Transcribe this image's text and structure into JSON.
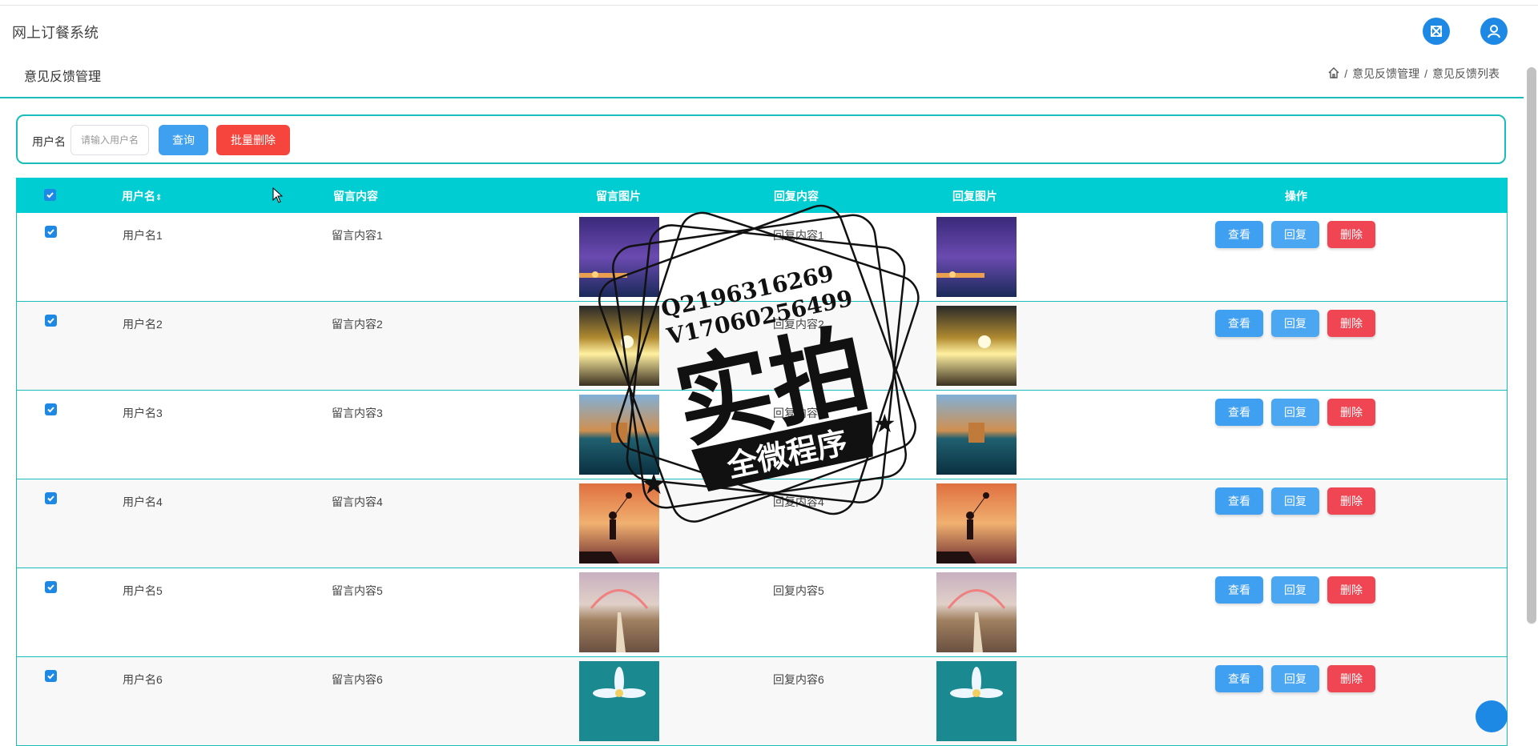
{
  "app_title": "网上订餐系统",
  "page_title": "意见反馈管理",
  "breadcrumb": {
    "sep": "/",
    "level1": "意见反馈管理",
    "level2": "意见反馈列表"
  },
  "search": {
    "label": "用户名",
    "placeholder": "请输入用户名",
    "query_button": "查询",
    "batch_delete_button": "批量删除"
  },
  "table": {
    "headers": {
      "username": "用户名",
      "sort_glyph": "⇕",
      "message_content": "留言内容",
      "message_image": "留言图片",
      "reply_content": "回复内容",
      "reply_image": "回复图片",
      "actions": "操作"
    },
    "rows": [
      {
        "username": "用户名1",
        "message": "留言内容1",
        "reply": "回复内容1"
      },
      {
        "username": "用户名2",
        "message": "留言内容2",
        "reply": "回复内容2"
      },
      {
        "username": "用户名3",
        "message": "留言内容3",
        "reply": "回复内容3"
      },
      {
        "username": "用户名4",
        "message": "留言内容4",
        "reply": "回复内容4"
      },
      {
        "username": "用户名5",
        "message": "留言内容5",
        "reply": "回复内容5"
      },
      {
        "username": "用户名6",
        "message": "留言内容6",
        "reply": "回复内容6"
      }
    ],
    "action_labels": {
      "view": "查看",
      "reply": "回复",
      "delete": "删除"
    }
  },
  "watermark": {
    "line1": "Q2196316269",
    "line2": "V17060256499",
    "main": "实拍",
    "banner": "全微程序"
  },
  "colors": {
    "accent": "#1abcbc",
    "header_bg": "#00cdd1",
    "primary": "#40a0f0",
    "danger": "#f5453d"
  },
  "icons": [
    "fullscreen-icon",
    "user-icon",
    "home-icon",
    "sort-icon"
  ]
}
